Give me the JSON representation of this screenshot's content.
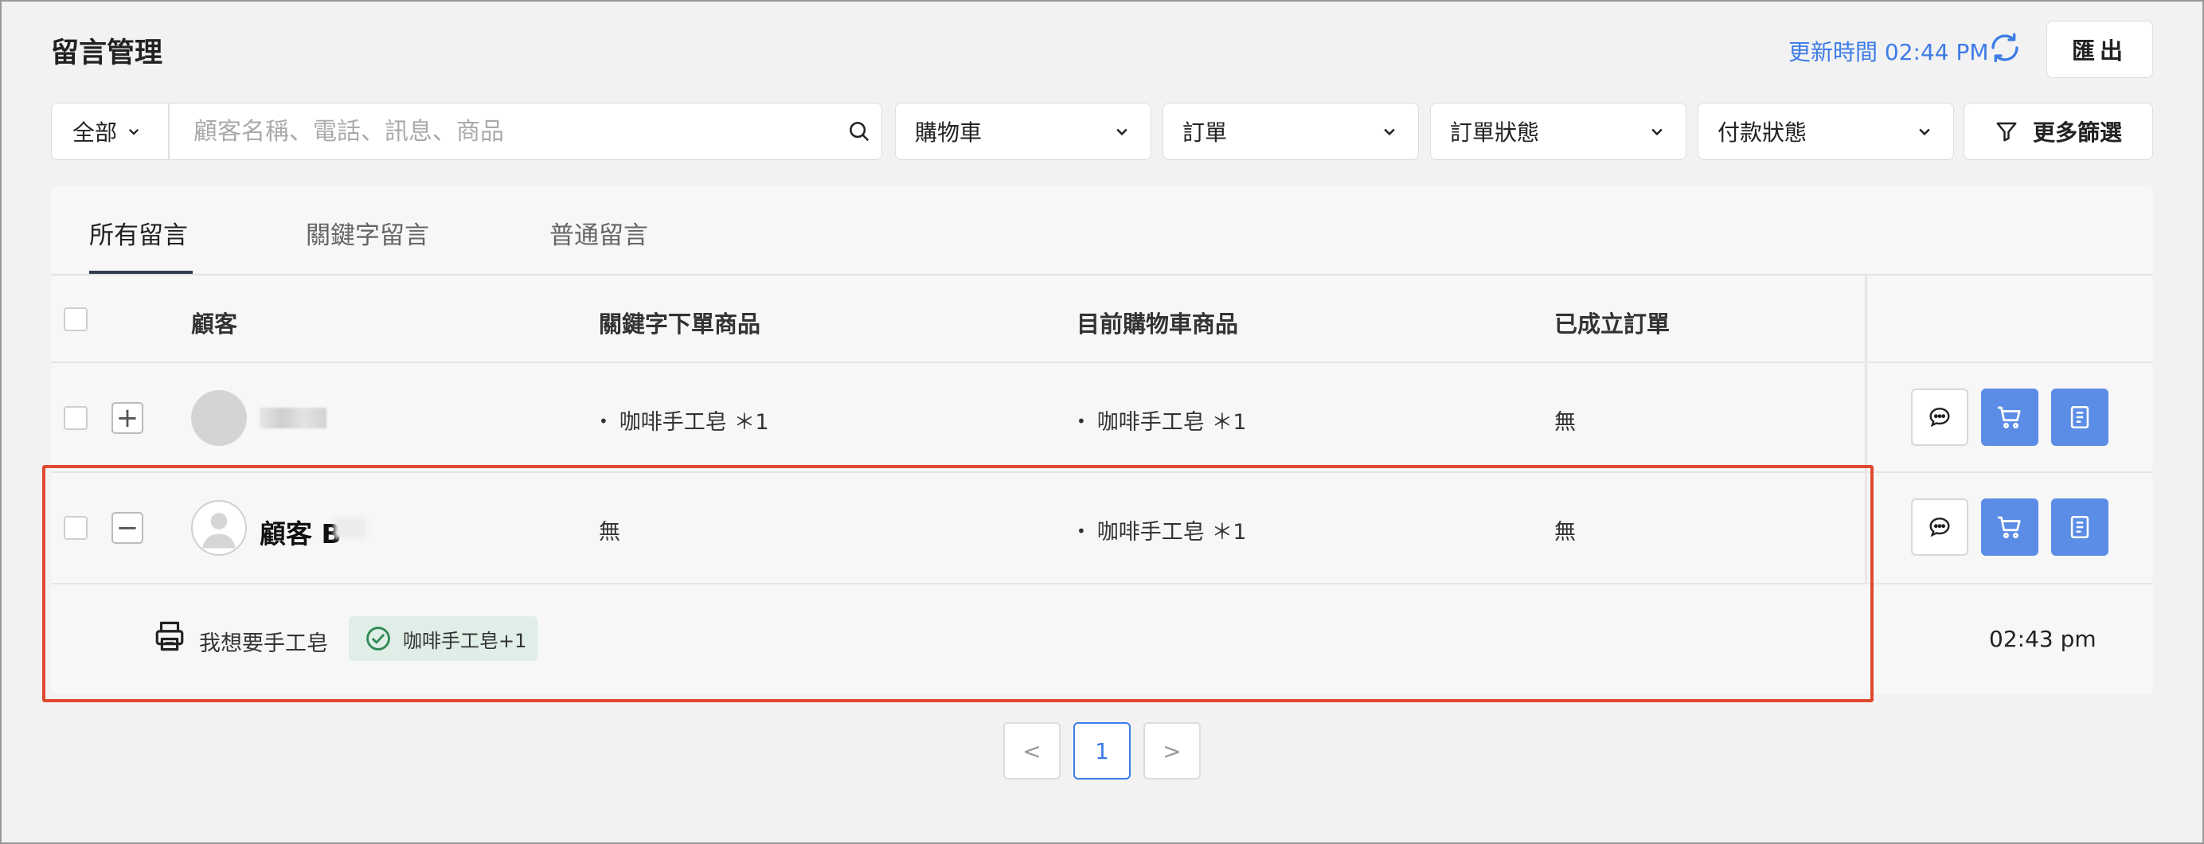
{
  "header": {
    "title": "留言管理",
    "update_time_label": "更新時間 02:44 PM",
    "export_label": "匯出"
  },
  "filters": {
    "scope": "全部",
    "search_placeholder": "顧客名稱、電話、訊息、商品",
    "cart": "購物車",
    "order": "訂單",
    "order_status": "訂單狀態",
    "payment_status": "付款狀態",
    "more_filters": "更多篩選"
  },
  "tabs": [
    {
      "label": "所有留言",
      "active": true
    },
    {
      "label": "關鍵字留言",
      "active": false
    },
    {
      "label": "普通留言",
      "active": false
    }
  ],
  "columns": {
    "customer": "顧客",
    "keyword_products": "關鍵字下單商品",
    "cart_products": "目前購物車商品",
    "orders": "已成立訂單"
  },
  "rows": [
    {
      "customer": "",
      "expanded": false,
      "expand_symbol": "+",
      "keyword_products": "咖啡手工皂 ＊1",
      "cart_products": "咖啡手工皂 ＊1",
      "orders": "無"
    },
    {
      "customer": "顧客 B",
      "expanded": true,
      "expand_symbol": "−",
      "keyword_products": "無",
      "cart_products": "咖啡手工皂 ＊1",
      "orders": "無"
    }
  ],
  "expanded_comment": {
    "text": "我想要手工皂",
    "tag": "咖啡手工皂+1",
    "time": "02:43 pm"
  },
  "pagination": {
    "prev": "<",
    "current": "1",
    "next": ">"
  },
  "colors": {
    "accent": "#3d7be6",
    "action_blue": "#5b8de6",
    "highlight": "#e0492f",
    "tag_bg": "#dfeee6"
  },
  "icons": [
    "refresh-icon",
    "search-icon",
    "chevron-down-icon",
    "filter-icon",
    "chat-icon",
    "cart-icon",
    "order-icon",
    "printer-icon",
    "check-circle-icon",
    "avatar-icon"
  ]
}
